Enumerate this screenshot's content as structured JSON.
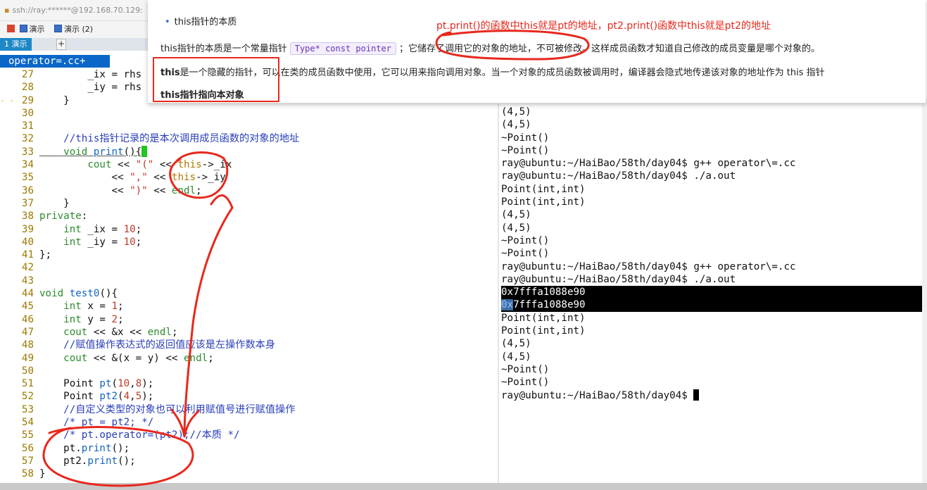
{
  "ssh": {
    "address": "ssh://ray:******@192.168.70.129:"
  },
  "toolbar": {
    "items": [
      "演示",
      "演示 (2)"
    ]
  },
  "tabs": {
    "active": "1 演示",
    "add": "+"
  },
  "vim": {
    "file_tab": "operator=.cc+",
    "lines": [
      {
        "num": "27",
        "text": "        _ix = rhs"
      },
      {
        "num": "28",
        "text": "        _iy = rhs"
      },
      {
        "num": "29",
        "text": "    }",
        "gutter": "- -"
      },
      {
        "num": "30",
        "text": ""
      },
      {
        "num": "31",
        "text": ""
      },
      {
        "num": "32",
        "text": "    //this指针记录的是本次调用成员函数的对象的地址"
      },
      {
        "num": "33",
        "text": "    void print(){"
      },
      {
        "num": "34",
        "text": "        cout << \"(\" << this->_ix"
      },
      {
        "num": "35",
        "text": "            << \",\" << this->_iy"
      },
      {
        "num": "36",
        "text": "            << \")\" << endl;"
      },
      {
        "num": "37",
        "text": "    }"
      },
      {
        "num": "38",
        "text": "private:"
      },
      {
        "num": "39",
        "text": "    int _ix = 10;"
      },
      {
        "num": "40",
        "text": "    int _iy = 10;"
      },
      {
        "num": "41",
        "text": "};"
      },
      {
        "num": "42",
        "text": ""
      },
      {
        "num": "43",
        "text": ""
      },
      {
        "num": "44",
        "text": "void test0(){"
      },
      {
        "num": "45",
        "text": "    int x = 1;"
      },
      {
        "num": "46",
        "text": "    int y = 2;"
      },
      {
        "num": "47",
        "text": "    cout << &x << endl;"
      },
      {
        "num": "48",
        "text": "    //赋值操作表达式的返回值应该是左操作数本身"
      },
      {
        "num": "49",
        "text": "    cout << &(x = y) << endl;"
      },
      {
        "num": "50",
        "text": ""
      },
      {
        "num": "51",
        "text": "    Point pt(10,8);"
      },
      {
        "num": "52",
        "text": "    Point pt2(4,5);"
      },
      {
        "num": "53",
        "text": "    //自定义类型的对象也可以利用赋值号进行赋值操作"
      },
      {
        "num": "54",
        "text": "    /* pt = pt2; */"
      },
      {
        "num": "55",
        "text": "    /* pt.operator=(pt2);//本质 */"
      },
      {
        "num": "56",
        "text": "    pt.print();"
      },
      {
        "num": "57",
        "text": "    pt2.print();"
      },
      {
        "num": "58",
        "text": "}"
      }
    ]
  },
  "terminal": {
    "lines": [
      "(4,5)",
      "(4,5)",
      "~Point()",
      "~Point()",
      "ray@ubuntu:~/HaiBao/58th/day04$ g++ operator\\=.cc",
      "ray@ubuntu:~/HaiBao/58th/day04$ ./a.out",
      "Point(int,int)",
      "Point(int,int)",
      "(4,5)",
      "(4,5)",
      "~Point()",
      "~Point()",
      "ray@ubuntu:~/HaiBao/58th/day04$ g++ operator\\=.cc",
      "ray@ubuntu:~/HaiBao/58th/day04$ ./a.out",
      "0x7fffa1088e90",
      "7fffa1088e90",
      "Point(int,int)",
      "Point(int,int)",
      "(4,5)",
      "(4,5)",
      "~Point()",
      "~Point()",
      "ray@ubuntu:~/HaiBao/58th/day04$ "
    ],
    "selected_prefix": "0x"
  },
  "doc": {
    "title": "this指针的本质",
    "line1_pre": "this指针的本质是一个常量指针",
    "line1_code": "Type* const pointer",
    "line1_post": "；它储存了调用它的对象的地址，不可被修改。这样成员函数才知道自己修改的成员变量是哪个对象的。",
    "line2_bold": "this",
    "line2_rest": "是一个隐藏的指针，可以在类的成员函数中使用，它可以用来指向调用对象。当一个对象的成员函数被调用时，编译器会隐式地传递该对象的地址作为 this 指针",
    "line3": "this指针指向本对象",
    "note": "pt.print()的函数中this就是pt的地址，pt2.print()函数中this就是pt2的地址"
  },
  "colors": {
    "annotation_red": "#e8281d",
    "vim_tab_blue": "#0a67c7",
    "tab_blue": "#1e88c7"
  }
}
